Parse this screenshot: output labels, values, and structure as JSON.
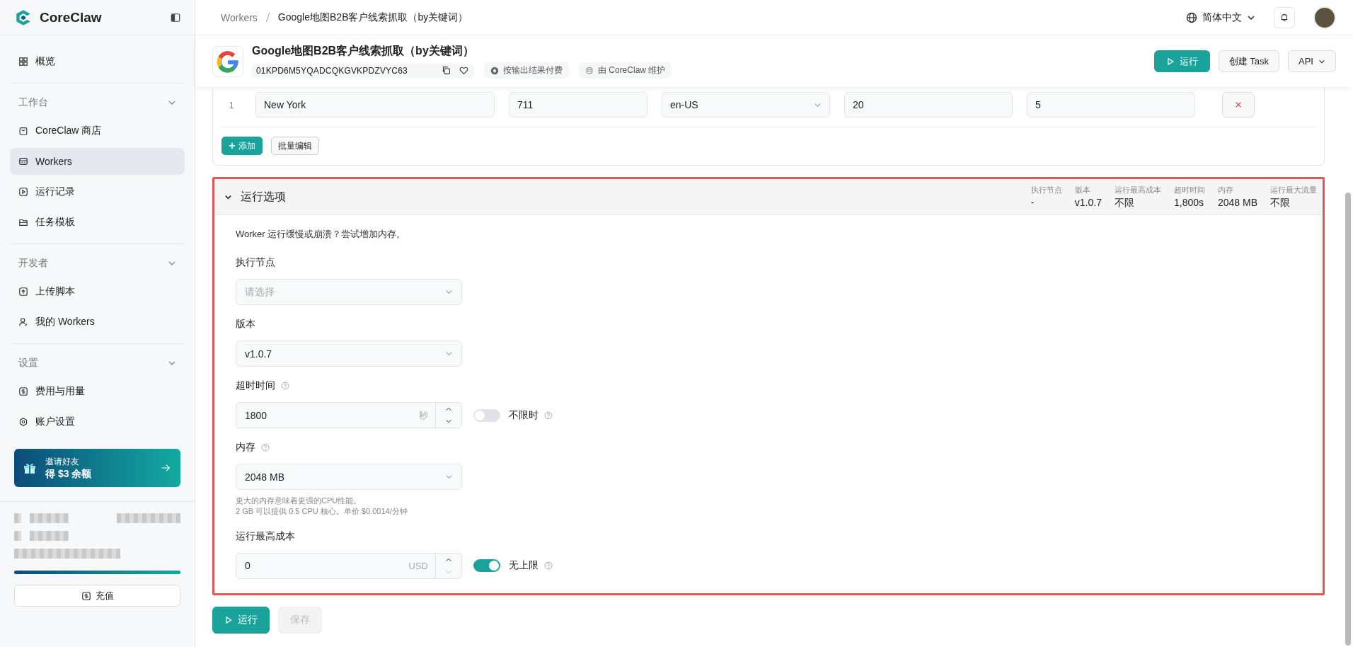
{
  "sidebar": {
    "brand": "CoreClaw",
    "nav_top": [
      {
        "label": "概览",
        "selected": false
      }
    ],
    "nav_sections": [
      {
        "title": "工作台",
        "expanded": true,
        "items": [
          {
            "label": "CoreClaw 商店",
            "selected": false
          },
          {
            "label": "Workers",
            "selected": true
          },
          {
            "label": "运行记录",
            "selected": false
          },
          {
            "label": "任务模板",
            "selected": false
          }
        ]
      },
      {
        "title": "开发者",
        "expanded": true,
        "items": [
          {
            "label": "上传脚本",
            "selected": false
          },
          {
            "label": "我的 Workers",
            "selected": false
          }
        ]
      },
      {
        "title": "设置",
        "expanded": true,
        "items": [
          {
            "label": "费用与用量",
            "selected": false
          },
          {
            "label": "账户设置",
            "selected": false
          }
        ]
      }
    ],
    "promo": {
      "line1": "邀请好友",
      "line2": "得 $3 余额"
    },
    "usage_bar": {
      "level": 1
    },
    "recharge_button": "充值"
  },
  "topbar": {
    "breadcrumb": [
      "Workers",
      "Google地图B2B客户线索抓取（by关键词）"
    ],
    "language": "简体中文"
  },
  "worker": {
    "title": "Google地图B2B客户线索抓取（by关键词）",
    "id": "01KPD6M5YQADCQKGVKPDZVYC63",
    "tags": [
      "按输出结果付费",
      "由 CoreClaw 维护"
    ],
    "actions": [
      {
        "label": "运行",
        "kind": "primary"
      },
      {
        "label": "创建 Task",
        "kind": "default"
      },
      {
        "label": "API",
        "kind": "dropdown"
      }
    ]
  },
  "input_rows": [
    {
      "index": "1",
      "cells": [
        {
          "kind": "text",
          "value": "New York"
        },
        {
          "kind": "text",
          "value": "711"
        },
        {
          "kind": "select",
          "value": "en-US"
        },
        {
          "kind": "text",
          "value": "20"
        },
        {
          "kind": "text",
          "value": "5"
        }
      ]
    }
  ],
  "input_buttons": [
    {
      "label": "添加",
      "kind": "primary"
    },
    {
      "label": "批量编辑",
      "kind": "default"
    }
  ],
  "run_options": {
    "title": "运行选项",
    "expanded": true,
    "highlighted": true,
    "summary": [
      {
        "label": "执行节点",
        "value": "-"
      },
      {
        "label": "版本",
        "value": "v1.0.7"
      },
      {
        "label": "运行最高成本",
        "value": "不限"
      },
      {
        "label": "超时时间",
        "value": "1,800s"
      },
      {
        "label": "内存",
        "value": "2048 MB"
      },
      {
        "label": "运行最大流量",
        "value": "不限"
      }
    ],
    "hint": "Worker 运行缓慢或崩溃？尝试增加内存。",
    "fields": [
      {
        "kind": "select",
        "label": "执行节点",
        "help": false,
        "placeholder": "请选择"
      },
      {
        "kind": "select",
        "label": "版本",
        "help": false,
        "value": "v1.0.7"
      },
      {
        "kind": "number",
        "label": "超时时间",
        "help": true,
        "value": "1800",
        "unit": "秒",
        "toggle": {
          "label": "不限时",
          "on": false
        }
      },
      {
        "kind": "select",
        "label": "内存",
        "help": true,
        "value": "2048 MB",
        "notes": [
          "更大的内存意味着更强的CPU性能。",
          "2 GB 可以提供 0.5 CPU 核心。单价 $0.0014/分钟"
        ]
      },
      {
        "kind": "number",
        "label": "运行最高成本",
        "help": false,
        "value": "0",
        "unit": "USD",
        "toggle": {
          "label": "无上限",
          "on": true
        }
      }
    ]
  },
  "footer_buttons": [
    {
      "label": "运行",
      "kind": "primary",
      "disabled": false
    },
    {
      "label": "保存",
      "kind": "default",
      "disabled": true
    }
  ]
}
